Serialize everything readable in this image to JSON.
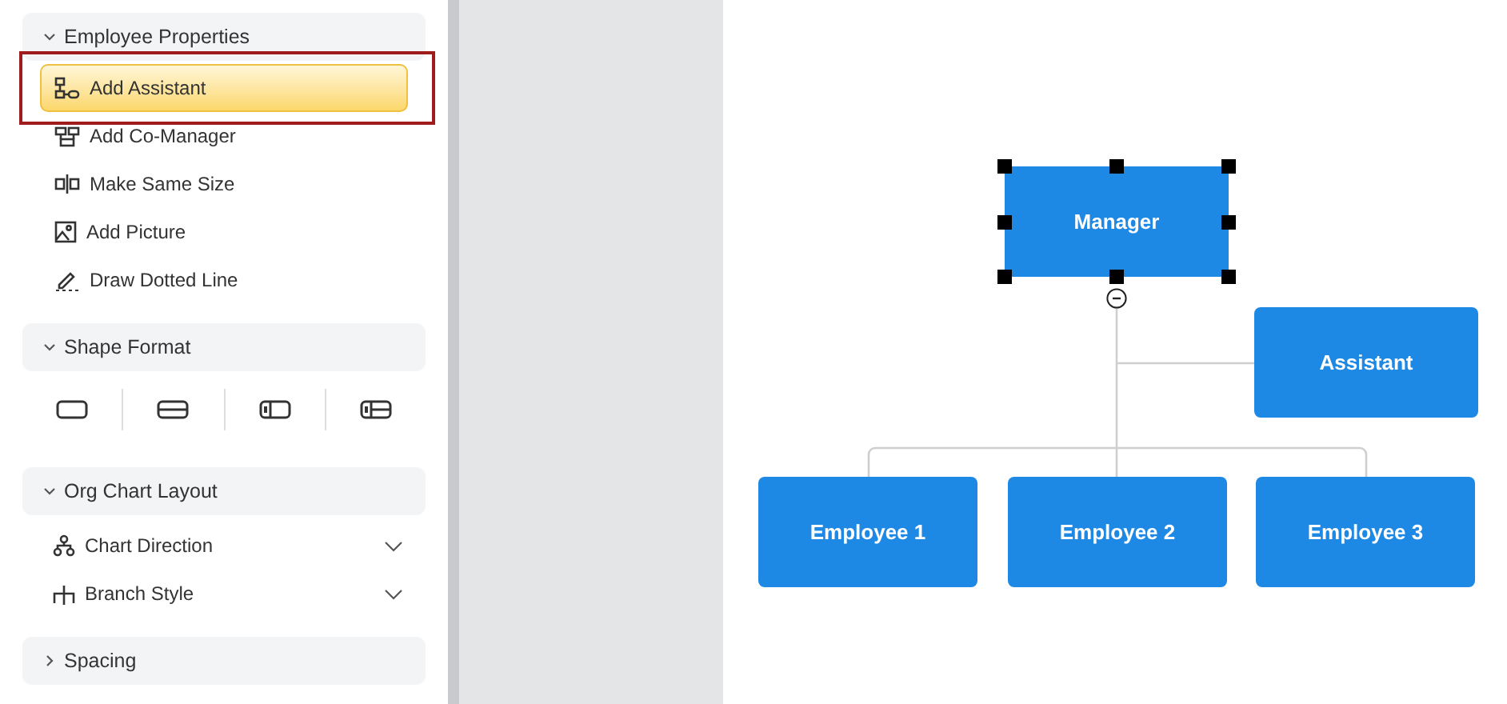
{
  "sidebar": {
    "sections": [
      {
        "title": "Employee Properties",
        "expanded": true,
        "kind": "actions",
        "items": [
          {
            "label": "Add Assistant",
            "selected": true
          },
          {
            "label": "Add Co-Manager",
            "selected": false
          },
          {
            "label": "Make Same Size",
            "selected": false
          },
          {
            "label": "Add Picture",
            "selected": false
          },
          {
            "label": "Draw Dotted Line",
            "selected": false
          }
        ]
      },
      {
        "title": "Shape Format",
        "expanded": true,
        "kind": "shapes"
      },
      {
        "title": "Org Chart Layout",
        "expanded": true,
        "kind": "dropdowns",
        "items": [
          {
            "label": "Chart Direction",
            "expanded": false
          },
          {
            "label": "Branch Style",
            "expanded": false
          }
        ]
      },
      {
        "title": "Spacing",
        "expanded": false
      }
    ]
  },
  "canvas": {
    "nodes": [
      {
        "label": "Manager",
        "selected": true
      },
      {
        "label": "Assistant",
        "selected": false
      },
      {
        "label": "Employee 1",
        "selected": false
      },
      {
        "label": "Employee 2",
        "selected": false
      },
      {
        "label": "Employee 3",
        "selected": false
      }
    ]
  }
}
